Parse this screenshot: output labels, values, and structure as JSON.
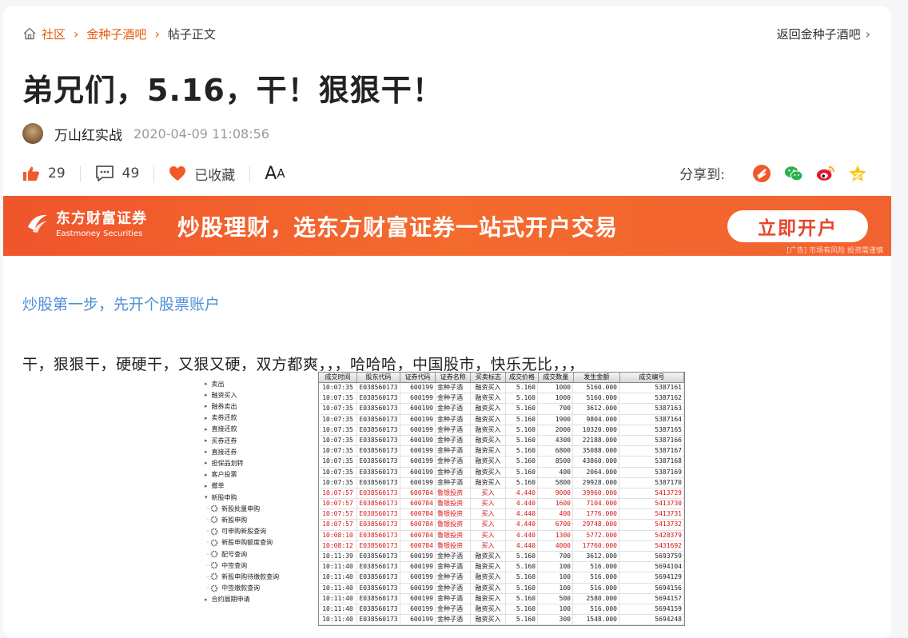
{
  "breadcrumb": {
    "items": [
      "社区",
      "金种子酒吧"
    ],
    "current": "帖子正文",
    "back_label": "返回金种子酒吧"
  },
  "post": {
    "title": "弟兄们，5.16，干！狠狠干！",
    "author": "万山红实战",
    "time": "2020-04-09 11:08:56",
    "likes": "29",
    "comments": "49",
    "favorite_label": "已收藏",
    "font_label_big": "A",
    "font_label_small": "A",
    "share_label": "分享到:",
    "guide_link": "炒股第一步，先开个股票账户",
    "body": "干，狠狠干，硬硬干，又狠又硬，双方都爽，，，哈哈哈，中国股市，快乐无比，，，"
  },
  "ad": {
    "brand_cn": "东方财富证券",
    "brand_en": "Eastmoney Securities",
    "slogan": "炒股理财，选东方财富证券一站式开户交易",
    "button": "立即开户",
    "note": "[广告] 市场有风险 投资需谨慎"
  },
  "icons": {
    "home": "home-icon",
    "like": "thumbs-up-icon",
    "comment": "comment-icon",
    "favorite": "heart-icon",
    "share": [
      "toutiao-icon",
      "wechat-icon",
      "weibo-icon",
      "qzone-icon"
    ]
  },
  "colors": {
    "accent": "#e8590c",
    "link": "#4d8fd6",
    "ad_bg": "#f0552c",
    "sell_red": "#d81414"
  },
  "screenshot": {
    "tree": [
      {
        "label": "卖出",
        "level": 1,
        "arrow": true
      },
      {
        "label": "融资买入",
        "level": 1,
        "arrow": true
      },
      {
        "label": "融券卖出",
        "level": 1,
        "arrow": true
      },
      {
        "label": "卖券还款",
        "level": 1,
        "arrow": true
      },
      {
        "label": "直接还款",
        "level": 1,
        "arrow": true
      },
      {
        "label": "买券还券",
        "level": 1,
        "arrow": true
      },
      {
        "label": "直接还券",
        "level": 1,
        "arrow": true
      },
      {
        "label": "担保品划转",
        "level": 1,
        "arrow": true
      },
      {
        "label": "客户投票",
        "level": 1,
        "arrow": true
      },
      {
        "label": "撤单",
        "level": 1,
        "arrow": true
      },
      {
        "label": "新股申购",
        "level": 1,
        "arrow": false
      },
      {
        "label": "新股批量申购",
        "level": 2
      },
      {
        "label": "新股申购",
        "level": 2
      },
      {
        "label": "可申购新股查询",
        "level": 2
      },
      {
        "label": "新股申购额度查询",
        "level": 2
      },
      {
        "label": "配号查询",
        "level": 2
      },
      {
        "label": "中签查询",
        "level": 2
      },
      {
        "label": "新股申购待缴款查询",
        "level": 2
      },
      {
        "label": "中签缴款查询",
        "level": 2
      },
      {
        "label": "合约展期申请",
        "level": 1,
        "arrow": true
      }
    ],
    "headers": [
      "成交时间",
      "股东代码",
      "证券代码",
      "证券名称",
      "买卖标志",
      "成交价格",
      "成交数量",
      "发生金额",
      "成交编号"
    ],
    "rows": [
      {
        "red": false,
        "cells": [
          "10:07:35",
          "E038560173",
          "600199",
          "金种子酒",
          "融资买入",
          "5.160",
          "1000",
          "5160.000",
          "5387161"
        ]
      },
      {
        "red": false,
        "cells": [
          "10:07:35",
          "E038560173",
          "600199",
          "金种子酒",
          "融资买入",
          "5.160",
          "1000",
          "5160.000",
          "5387162"
        ]
      },
      {
        "red": false,
        "cells": [
          "10:07:35",
          "E038560173",
          "600199",
          "金种子酒",
          "融资买入",
          "5.160",
          "700",
          "3612.000",
          "5387163"
        ]
      },
      {
        "red": false,
        "cells": [
          "10:07:35",
          "E038560173",
          "600199",
          "金种子酒",
          "融资买入",
          "5.160",
          "1900",
          "9804.000",
          "5387164"
        ]
      },
      {
        "red": false,
        "cells": [
          "10:07:35",
          "E038560173",
          "600199",
          "金种子酒",
          "融资买入",
          "5.160",
          "2000",
          "10320.000",
          "5387165"
        ]
      },
      {
        "red": false,
        "cells": [
          "10:07:35",
          "E038560173",
          "600199",
          "金种子酒",
          "融资买入",
          "5.160",
          "4300",
          "22188.000",
          "5387166"
        ]
      },
      {
        "red": false,
        "cells": [
          "10:07:35",
          "E038560173",
          "600199",
          "金种子酒",
          "融资买入",
          "5.160",
          "6800",
          "35088.000",
          "5387167"
        ]
      },
      {
        "red": false,
        "cells": [
          "10:07:35",
          "E038560173",
          "600199",
          "金种子酒",
          "融资买入",
          "5.160",
          "8500",
          "43860.000",
          "5387168"
        ]
      },
      {
        "red": false,
        "cells": [
          "10:07:35",
          "E038560173",
          "600199",
          "金种子酒",
          "融资买入",
          "5.160",
          "400",
          "2064.000",
          "5387169"
        ]
      },
      {
        "red": false,
        "cells": [
          "10:07:35",
          "E038560173",
          "600199",
          "金种子酒",
          "融资买入",
          "5.160",
          "5800",
          "29928.000",
          "5387170"
        ]
      },
      {
        "red": true,
        "cells": [
          "10:07:57",
          "E038560173",
          "600784",
          "鲁银投资",
          "买入",
          "4.440",
          "9000",
          "39960.000",
          "5413729"
        ]
      },
      {
        "red": true,
        "cells": [
          "10:07:57",
          "E038560173",
          "600784",
          "鲁银投资",
          "买入",
          "4.440",
          "1600",
          "7104.000",
          "5413730"
        ]
      },
      {
        "red": true,
        "cells": [
          "10:07:57",
          "E038560173",
          "600784",
          "鲁银投资",
          "买入",
          "4.440",
          "400",
          "1776.000",
          "5413731"
        ]
      },
      {
        "red": true,
        "cells": [
          "10:07:57",
          "E038560173",
          "600784",
          "鲁银投资",
          "买入",
          "4.440",
          "6700",
          "29748.000",
          "5413732"
        ]
      },
      {
        "red": true,
        "cells": [
          "10:08:10",
          "E038560173",
          "600784",
          "鲁银投资",
          "买入",
          "4.440",
          "1300",
          "5772.000",
          "5428379"
        ]
      },
      {
        "red": true,
        "cells": [
          "10:08:12",
          "E038560173",
          "600784",
          "鲁银投资",
          "买入",
          "4.440",
          "4000",
          "17760.000",
          "5431692"
        ]
      },
      {
        "red": false,
        "cells": [
          "10:11:39",
          "E038560173",
          "600199",
          "金种子酒",
          "融资买入",
          "5.160",
          "700",
          "3612.000",
          "5693759"
        ]
      },
      {
        "red": false,
        "cells": [
          "10:11:40",
          "E038560173",
          "600199",
          "金种子酒",
          "融资买入",
          "5.160",
          "100",
          "516.000",
          "5694104"
        ]
      },
      {
        "red": false,
        "cells": [
          "10:11:40",
          "E038560173",
          "600199",
          "金种子酒",
          "融资买入",
          "5.160",
          "100",
          "516.000",
          "5694129"
        ]
      },
      {
        "red": false,
        "cells": [
          "10:11:40",
          "E038560173",
          "600199",
          "金种子酒",
          "融资买入",
          "5.160",
          "100",
          "516.000",
          "5694156"
        ]
      },
      {
        "red": false,
        "cells": [
          "10:11:40",
          "E038560173",
          "600199",
          "金种子酒",
          "融资买入",
          "5.160",
          "500",
          "2580.000",
          "5694157"
        ]
      },
      {
        "red": false,
        "cells": [
          "10:11:40",
          "E038560173",
          "600199",
          "金种子酒",
          "融资买入",
          "5.160",
          "100",
          "516.000",
          "5694159"
        ]
      },
      {
        "red": false,
        "cells": [
          "10:11:40",
          "E038560173",
          "600199",
          "金种子酒",
          "融资买入",
          "5.160",
          "300",
          "1548.000",
          "5694248"
        ]
      }
    ]
  }
}
